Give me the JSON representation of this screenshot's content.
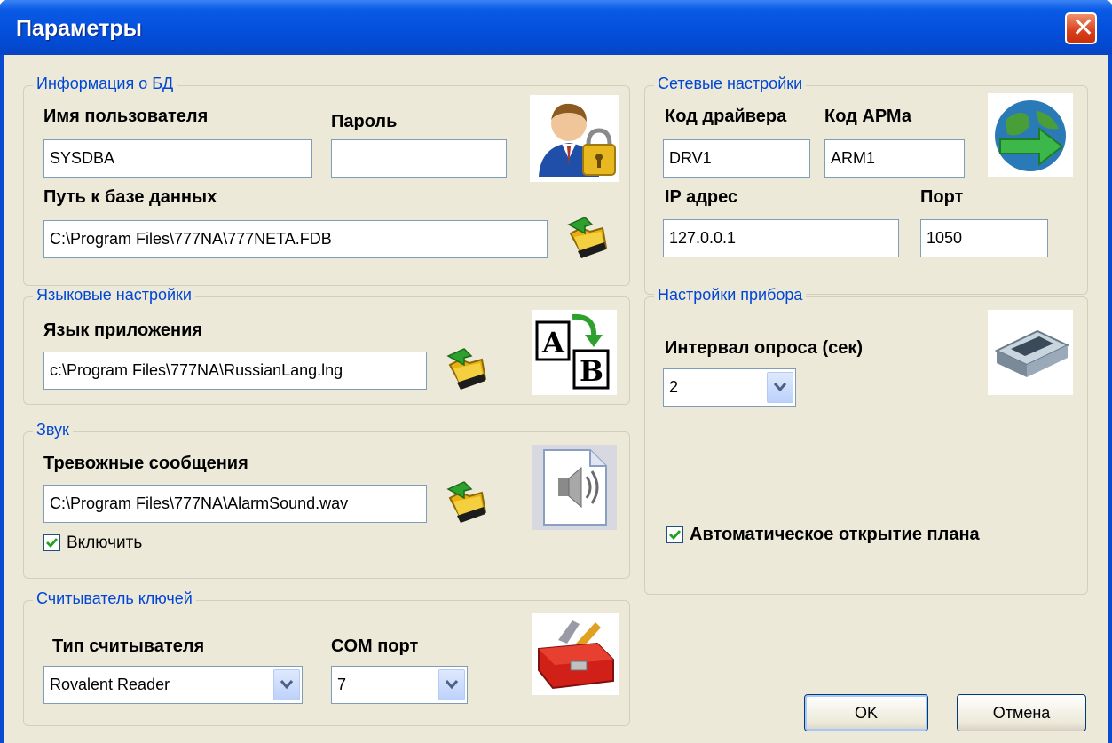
{
  "window": {
    "title": "Параметры"
  },
  "db": {
    "legend": "Информация о БД",
    "user_label": "Имя пользователя",
    "user_value": "SYSDBA",
    "password_label": "Пароль",
    "password_value": "",
    "path_label": "Путь к базе данных",
    "path_value": "C:\\Program Files\\777NA\\777NETA.FDB"
  },
  "language": {
    "legend": "Языковые настройки",
    "app_lang_label": "Язык приложения",
    "app_lang_value": "c:\\Program Files\\777NA\\RussianLang.lng"
  },
  "sound": {
    "legend": "Звук",
    "alarm_label": "Тревожные сообщения",
    "alarm_value": "C:\\Program Files\\777NA\\AlarmSound.wav",
    "enable_label": "Включить",
    "enable_checked": true
  },
  "reader": {
    "legend": "Считыватель ключей",
    "type_label": "Тип считывателя",
    "type_value": "Rovalent Reader",
    "com_label": "COM порт",
    "com_value": "7"
  },
  "network": {
    "legend": "Сетевые настройки",
    "driver_label": "Код драйвера",
    "driver_value": "DRV1",
    "arm_label": "Код АРМа",
    "arm_value": "ARM1",
    "ip_label": "IP адрес",
    "ip_value": "127.0.0.1",
    "port_label": "Порт",
    "port_value": "1050"
  },
  "device": {
    "legend": "Настройки прибора",
    "interval_label": "Интервал опроса (сек)",
    "interval_value": "2",
    "auto_open_label": "Автоматическое открытие плана",
    "auto_open_checked": true
  },
  "buttons": {
    "ok": "OK",
    "cancel": "Отмена"
  },
  "colors": {
    "titlebar": "#0450dc",
    "legend": "#0046d5",
    "dialog_bg": "#ece9d8",
    "check": "#21a121"
  }
}
